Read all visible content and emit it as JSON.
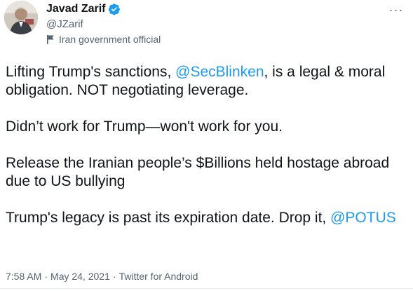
{
  "author": {
    "display_name": "Javad Zarif",
    "handle": "@JZarif",
    "label": "Iran government official",
    "avatar_icon": "avatar-photo",
    "verified_icon": "verified-badge-icon"
  },
  "menu": {
    "more_icon": "more-options-icon",
    "more_glyph": "···"
  },
  "body": {
    "p1_a": "Lifting Trump's sanctions, ",
    "p1_mention": "@SecBlinken",
    "p1_b": ", is a legal & moral obligation. NOT negotiating leverage.",
    "p2": "Didn’t work for Trump—won't work for you.",
    "p3": "Release the Iranian people’s $Billions held hostage abroad due to US bullying",
    "p4_a": "Trump's legacy is past its expiration date. Drop it, ",
    "p4_mention": "@POTUS"
  },
  "meta": {
    "time": "7:58 AM",
    "sep1": "·",
    "date": "May 24, 2021",
    "sep2": "·",
    "source": "Twitter for Android"
  },
  "colors": {
    "accent": "#1d9bf0",
    "text": "#0f1419",
    "muted": "#536471"
  }
}
